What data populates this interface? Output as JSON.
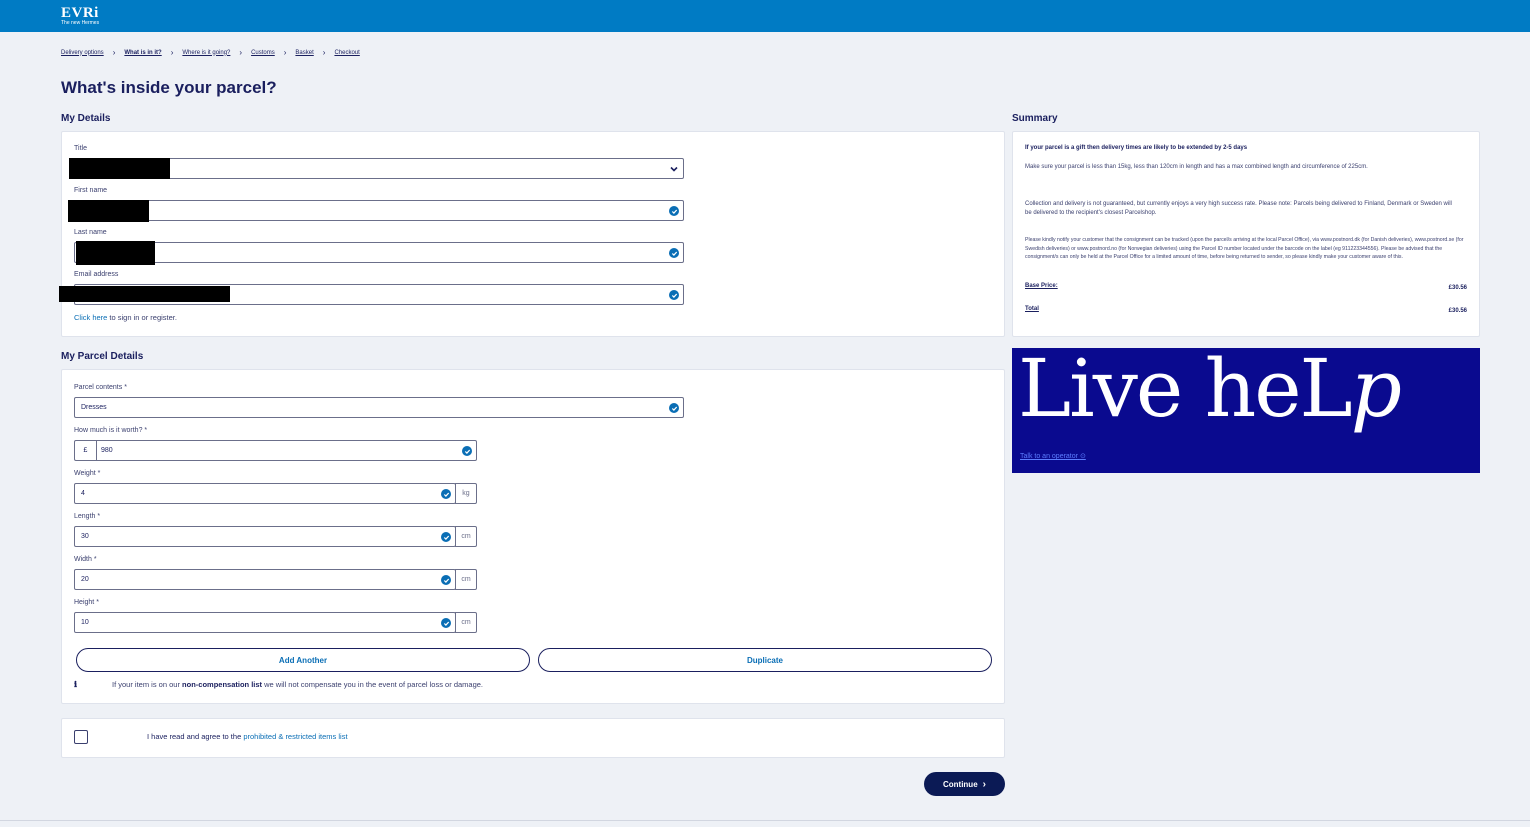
{
  "header": {
    "brand": "EVRi",
    "tagline": "The new Hermes"
  },
  "breadcrumb": [
    {
      "label": "Delivery options"
    },
    {
      "label": "What is in it?"
    },
    {
      "label": "Where is it going?"
    },
    {
      "label": "Customs"
    },
    {
      "label": "Basket"
    },
    {
      "label": "Checkout"
    }
  ],
  "page": {
    "title": "What's inside your parcel?"
  },
  "my_details": {
    "heading": "My Details",
    "title_label": "Title",
    "first_name_label": "First name",
    "last_name_label": "Last name",
    "email_label": "Email address",
    "signin_link": "Click here",
    "signin_rest": " to sign in or register."
  },
  "parcel": {
    "heading": "My Parcel Details",
    "contents_label": "Parcel contents",
    "contents_value": "Dresses",
    "worth_label": "How much is it worth?",
    "currency": "£",
    "worth_value": "980",
    "weight_label": "Weight",
    "weight_value": "4",
    "weight_unit": "kg",
    "length_label": "Length",
    "length_value": "30",
    "width_label": "Width",
    "width_value": "20",
    "height_label": "Height",
    "height_value": "10",
    "dim_unit": "cm",
    "required_mark": "*",
    "add_another": "Add Another",
    "duplicate": "Duplicate",
    "info_pre": "If your item is on our ",
    "info_link": "non-compensation list",
    "info_post": " we will not compensate you in the event of parcel loss or damage."
  },
  "agreement": {
    "pre": "I have read and agree to the ",
    "link": "prohibited & restricted items list"
  },
  "continue_label": "Continue",
  "summary": {
    "heading": "Summary",
    "gift_note": "If your parcel is a gift then delivery times are likely to be extended by 2-5 days",
    "size_note": "Make sure your parcel is less than 15kg, less than 120cm in length and has a max combined length and circumference of 225cm.",
    "delivery_note": "Collection and delivery is not guaranteed, but currently enjoys a very high success rate. Please note: Parcels being delivered to Finland, Denmark or Sweden will be delivered to the recipient's closest Parcelshop.",
    "tracking_note": "Please kindly notify your customer that the consignment can be tracked (upon the parcel/s arriving at the local Parcel Office), via www.postnord.dk (for Danish deliveries), www.postnord.se (for Swedish deliveries) or www.postnord.no (for Norwegian deliveries) using the Parcel ID number located under the barcode on the label (eg 911223344556). Please be advised that the consignment/s can only be held at the Parcel Office for a limited amount of time, before being returned to sender, so please kindly make your customer aware of this.",
    "base_price_label": "Base Price:",
    "base_price_value": "£30.56",
    "total_label": "Total",
    "total_value": "£30.56"
  },
  "livehelp": {
    "title_a": "Live",
    "title_b": "heL",
    "title_c": "p",
    "link": "Talk to an operator"
  },
  "colors": {
    "topbar": "#007bc4",
    "navy": "#1a1f5e",
    "accent": "#0a6eb5",
    "livehelp_bg": "#0a0a8f"
  }
}
